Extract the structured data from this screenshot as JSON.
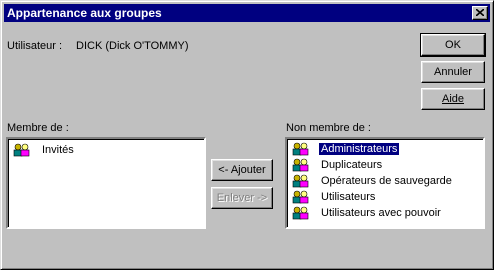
{
  "window": {
    "title": "Appartenance aux groupes"
  },
  "user": {
    "label": "Utilisateur :",
    "value": "DICK (Dick O'TOMMY)"
  },
  "buttons": {
    "ok": "OK",
    "cancel": "Annuler",
    "help": "Aide",
    "add": "<- Ajouter",
    "remove": "Enlever ->"
  },
  "member_of": {
    "label": "Membre de :",
    "items": [
      "Invités"
    ]
  },
  "not_member_of": {
    "label": "Non membre de :",
    "items": [
      "Administrateurs",
      "Duplicateurs",
      "Opérateurs de sauvegarde",
      "Utilisateurs",
      "Utilisateurs avec pouvoir"
    ],
    "selected": "Administrateurs"
  },
  "icons": {
    "group": "group-icon",
    "close": "close-icon"
  }
}
